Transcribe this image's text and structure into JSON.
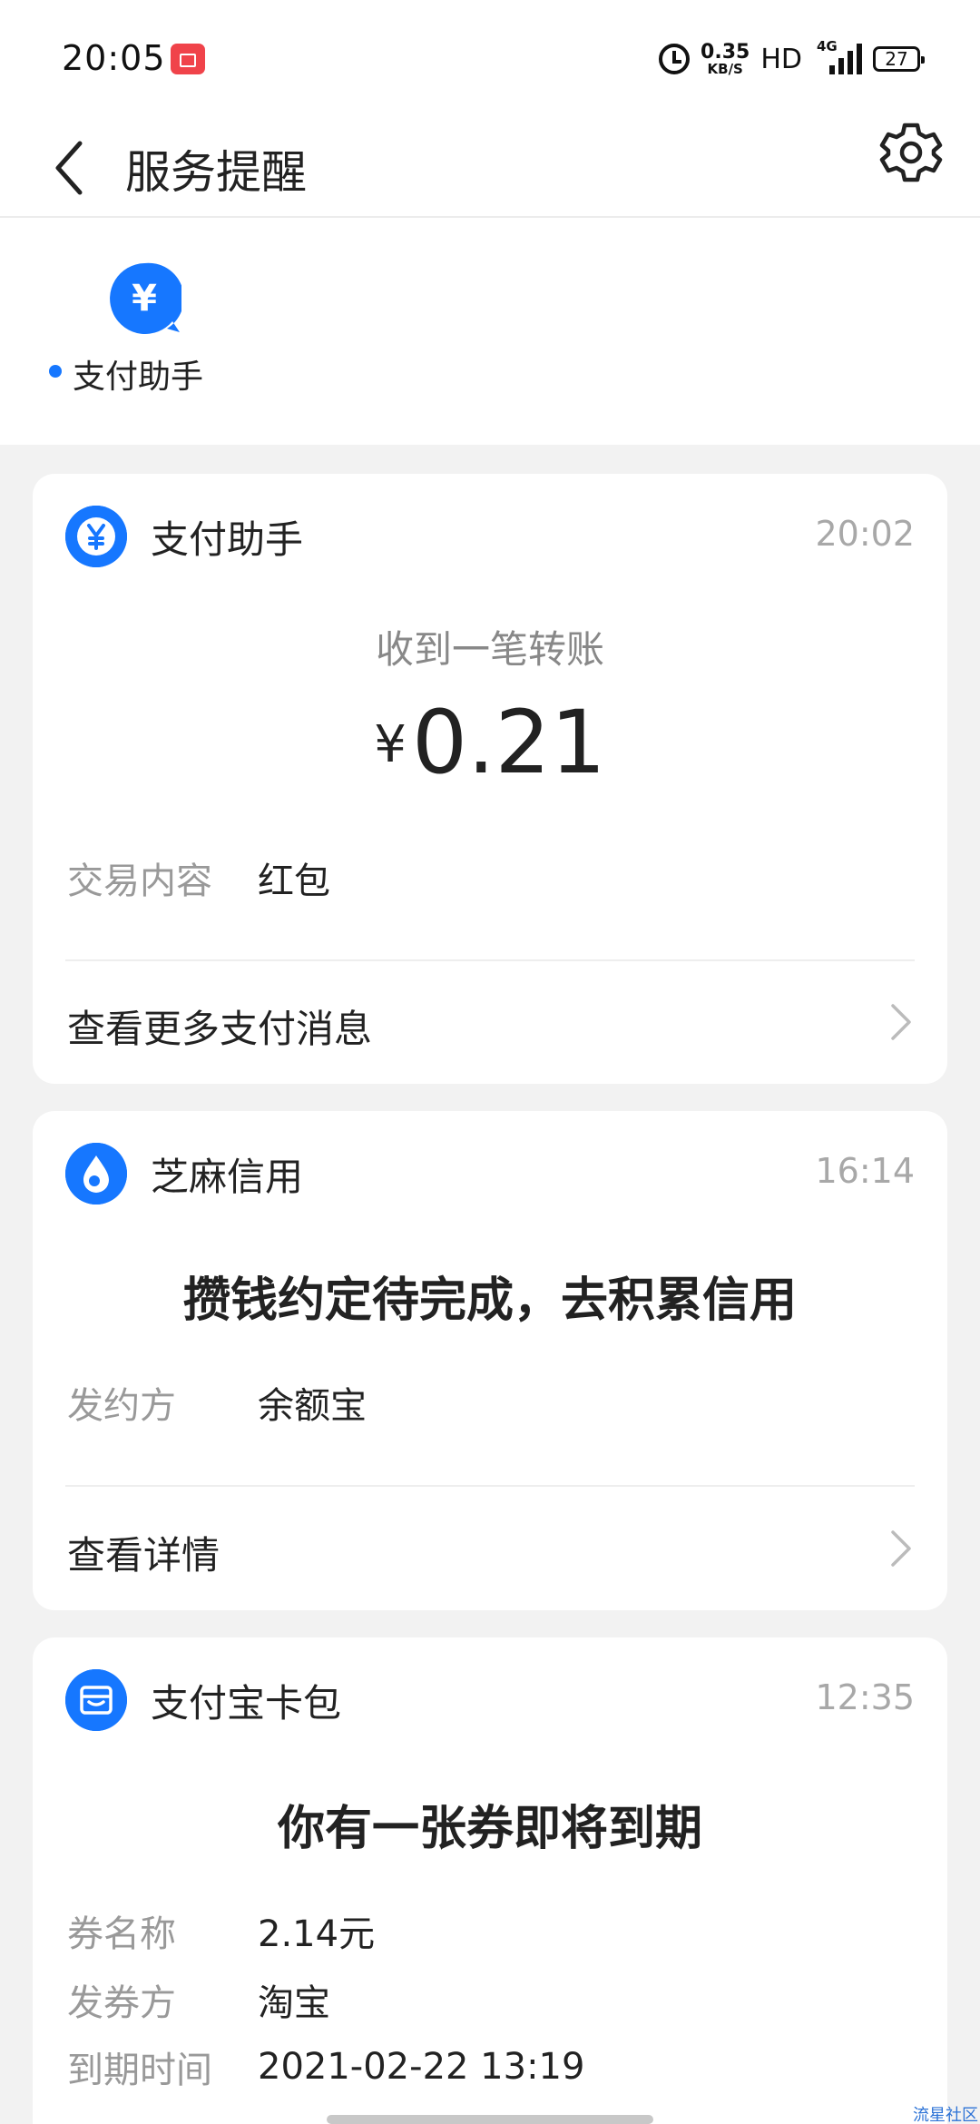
{
  "status_bar": {
    "time": "20:05",
    "net_speed_value": "0.35",
    "net_speed_unit": "KB/S",
    "hd_label": "HD",
    "network_type": "4G",
    "battery_level": "27"
  },
  "header": {
    "title": "服务提醒"
  },
  "account_strip": {
    "label": "支付助手",
    "icon_glyph": "¥"
  },
  "cards": [
    {
      "name": "支付助手",
      "time": "20:02",
      "subtitle": "收到一笔转账",
      "currency": "¥",
      "amount": "0.21",
      "rows": [
        {
          "key": "交易内容",
          "value": "红包"
        }
      ],
      "link": "查看更多支付消息"
    },
    {
      "name": "芝麻信用",
      "time": "16:14",
      "headline": "攒钱约定待完成，去积累信用",
      "rows": [
        {
          "key": "发约方",
          "value": "余额宝"
        }
      ],
      "link": "查看详情"
    },
    {
      "name": "支付宝卡包",
      "time": "12:35",
      "headline": "你有一张券即将到期",
      "rows": [
        {
          "key": "券名称",
          "value": "2.14元"
        },
        {
          "key": "发券方",
          "value": "淘宝"
        },
        {
          "key": "到期时间",
          "value": "2021-02-22 13:19"
        }
      ]
    }
  ],
  "watermark": "流星社区",
  "colors": {
    "accent": "#1677ff",
    "background": "#f2f2f2",
    "muted_text": "#999999"
  }
}
